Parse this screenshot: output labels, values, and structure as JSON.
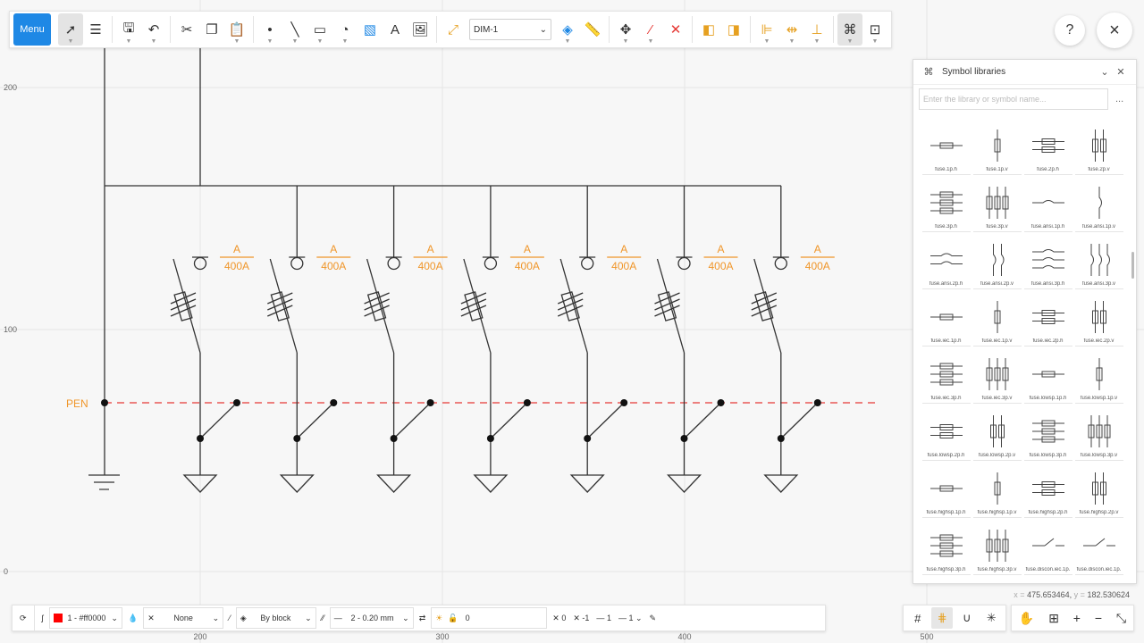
{
  "toolbar": {
    "menu_label": "Menu",
    "dim_style": "DIM-1",
    "help_icon": "?",
    "close_icon": "×"
  },
  "axis": {
    "y_labels": [
      "200",
      "100",
      "0"
    ],
    "x_labels": [
      "200",
      "300",
      "400",
      "500"
    ]
  },
  "drawing": {
    "pen_label": "PEN",
    "feeders": [
      {
        "top": "A",
        "bottom": "400A"
      },
      {
        "top": "A",
        "bottom": "400A"
      },
      {
        "top": "A",
        "bottom": "400A"
      },
      {
        "top": "A",
        "bottom": "400A"
      },
      {
        "top": "A",
        "bottom": "400A"
      },
      {
        "top": "A",
        "bottom": "400A"
      },
      {
        "top": "A",
        "bottom": "400A"
      }
    ],
    "colors": {
      "label": "#f0962a",
      "pen_line": "#e53935",
      "line": "#333333"
    }
  },
  "library": {
    "title": "Symbol libraries",
    "search_placeholder": "Enter the library or symbol name...",
    "more": "...",
    "symbols": [
      "fuse.1p.h",
      "fuse.1p.v",
      "fuse.2p.h",
      "fuse.2p.v",
      "fuse.3p.h",
      "fuse.3p.v",
      "fuse.ansi.1p.h",
      "fuse.ansi.1p.v",
      "fuse.ansi.2p.h",
      "fuse.ansi.2p.v",
      "fuse.ansi.3p.h",
      "fuse.ansi.3p.v",
      "fuse.iec.1p.h",
      "fuse.iec.1p.v",
      "fuse.iec.2p.h",
      "fuse.iec.2p.v",
      "fuse.iec.3p.h",
      "fuse.iec.3p.v",
      "fuse.lowsp.1p.h",
      "fuse.lowsp.1p.v",
      "fuse.lowsp.2p.h",
      "fuse.lowsp.2p.v",
      "fuse.lowsp.3p.h",
      "fuse.lowsp.3p.v",
      "fuse.highsp.1p.h",
      "fuse.highsp.1p.v",
      "fuse.highsp.2p.h",
      "fuse.highsp.2p.v",
      "fuse.highsp.3p.h",
      "fuse.highsp.3p.v",
      "fuse.discon.iec.1p.",
      "fuse.discon.iec.1p."
    ]
  },
  "coords": {
    "x_label": "x =",
    "x": "475.653464,",
    "y_label": "y =",
    "y": "182.530624"
  },
  "bottom_bar": {
    "color": "1 - #ff0000",
    "color_hex": "#ff0000",
    "linetype": "None",
    "layer": "By block",
    "lineweight": "2 - 0.20 mm",
    "layer_num": "0",
    "x_val": "0",
    "y_val": "-1",
    "scale1": "1",
    "scale2": "1"
  }
}
